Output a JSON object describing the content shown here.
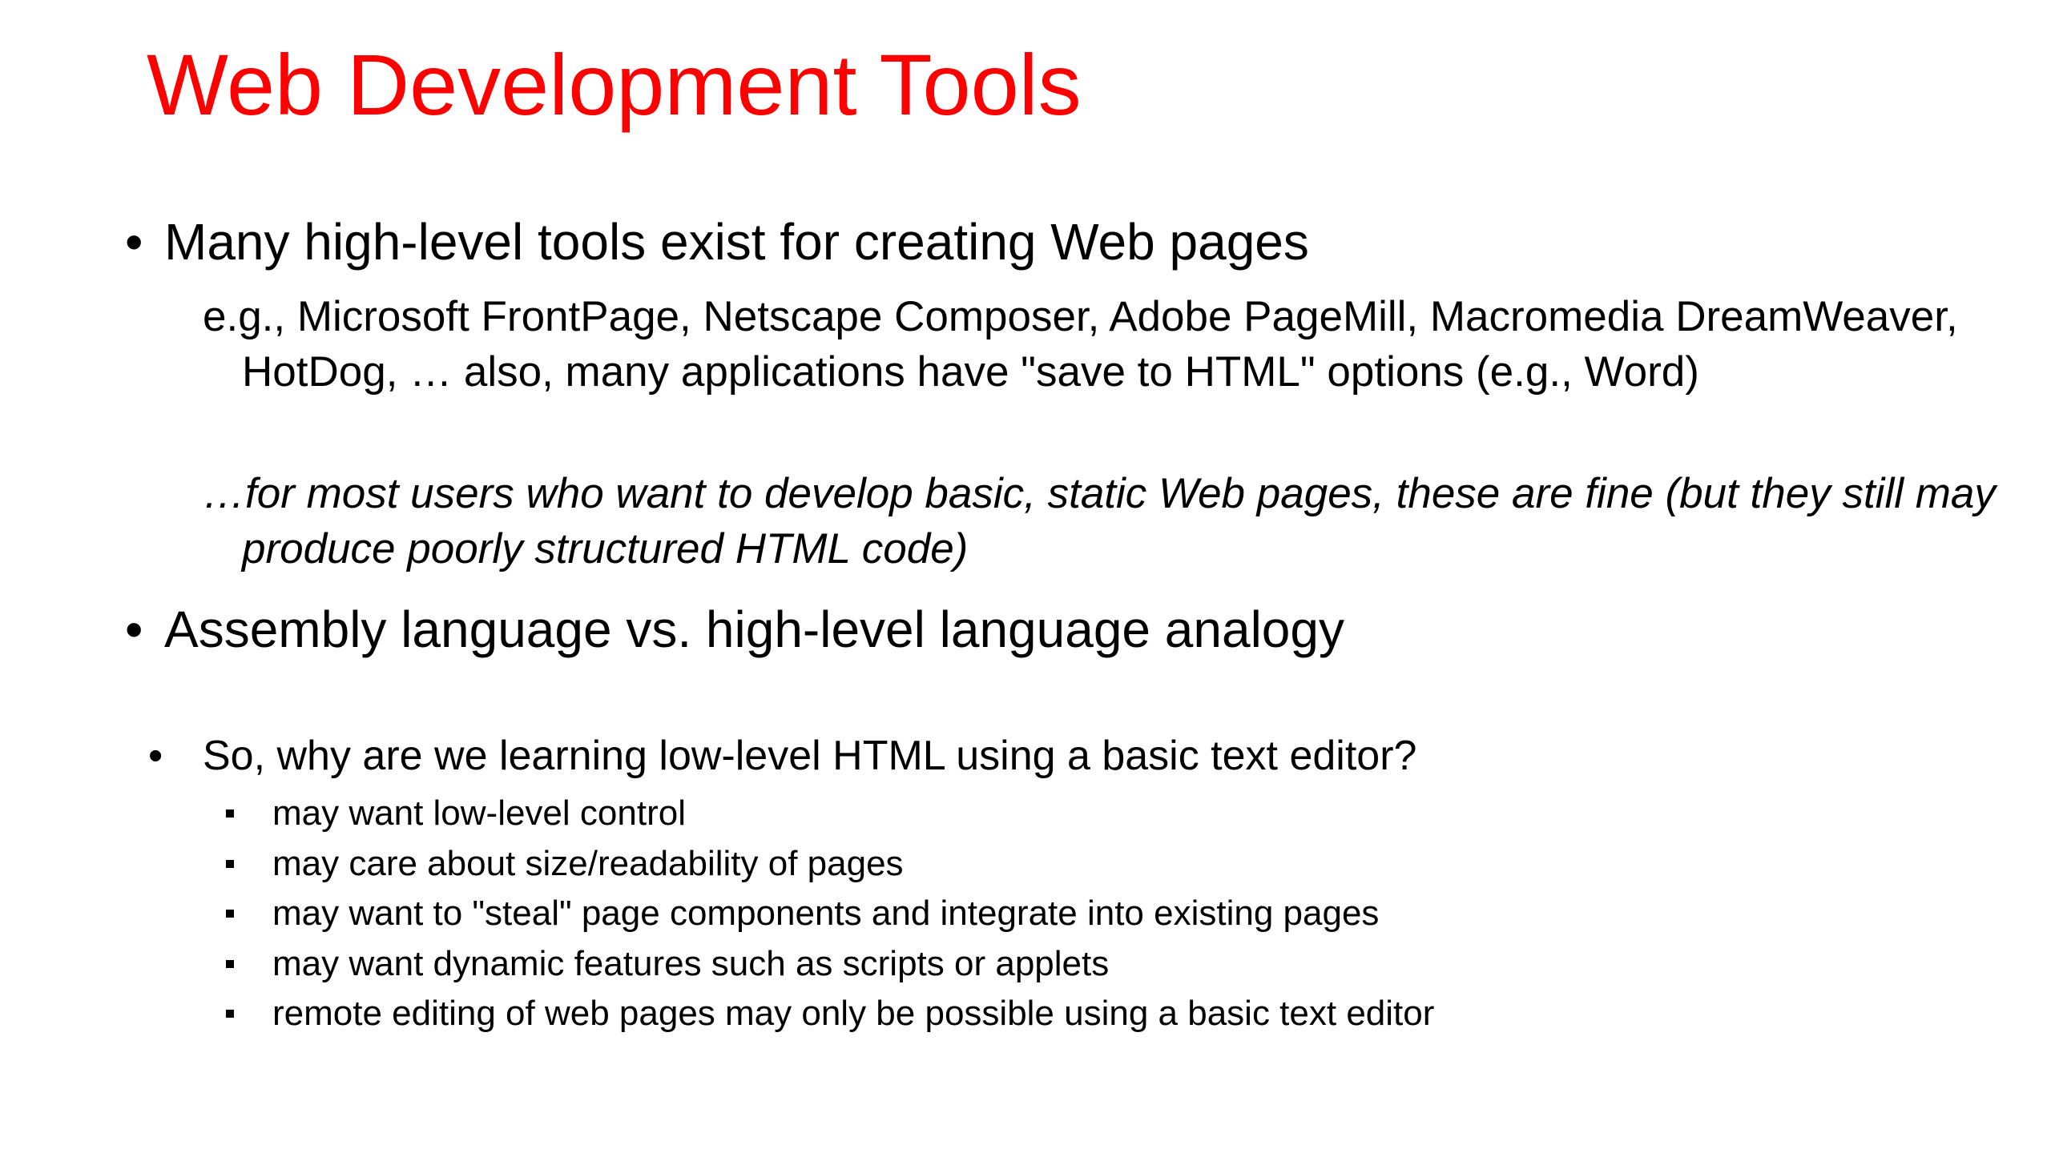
{
  "title": "Web Development Tools",
  "bullets": [
    {
      "marker": "•",
      "text": "Many high-level tools exist for creating Web pages",
      "details": [
        "e.g., Microsoft FrontPage, Netscape Composer, Adobe PageMill, Macromedia DreamWeaver, HotDog, … also, many applications have \"save to HTML\" options (e.g., Word)",
        "…for most users who want to develop basic, static Web pages, these are fine (but they still may produce poorly structured HTML code)"
      ]
    },
    {
      "marker": "•",
      "text": "Assembly language vs. high-level language analogy"
    }
  ],
  "question": {
    "marker": "•",
    "text": "So, why are we learning low-level HTML using a basic text editor?",
    "items": [
      "may want low-level control",
      "may care about size/readability of pages",
      "may want to \"steal\" page components and integrate into existing pages",
      "may want dynamic features such as scripts or applets",
      "remote editing of web pages may only be possible using a basic text editor"
    ]
  },
  "colors": {
    "title": "#ff0000",
    "text": "#000000",
    "background": "#ffffff"
  }
}
